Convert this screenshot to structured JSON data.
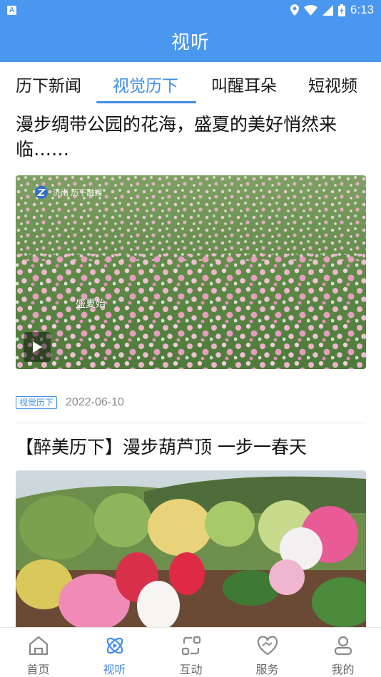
{
  "status_bar": {
    "time": "6:13",
    "app_badge": "A"
  },
  "header": {
    "title": "视听"
  },
  "tabs": [
    {
      "label": "历下新闻"
    },
    {
      "label": "视觉历下"
    },
    {
      "label": "叫醒耳朵"
    },
    {
      "label": "短视频"
    }
  ],
  "active_tab": "视觉历下",
  "articles": [
    {
      "title": "漫步绸带公园的花海，盛夏的美好悄然来临……",
      "image_watermark": "济南 历下融媒",
      "image_caption": "盛夏始",
      "tag": "视觉历下",
      "date": "2022-06-10",
      "has_video": true
    },
    {
      "title": "【醉美历下】漫步葫芦顶 一步一春天"
    }
  ],
  "bottom_nav": [
    {
      "label": "首页",
      "icon": "home-icon"
    },
    {
      "label": "视听",
      "icon": "atom-icon"
    },
    {
      "label": "互动",
      "icon": "interact-icon"
    },
    {
      "label": "服务",
      "icon": "handshake-icon"
    },
    {
      "label": "我的",
      "icon": "user-icon"
    }
  ],
  "colors": {
    "brand": "#4a97f0",
    "accent": "#3f8cea"
  }
}
